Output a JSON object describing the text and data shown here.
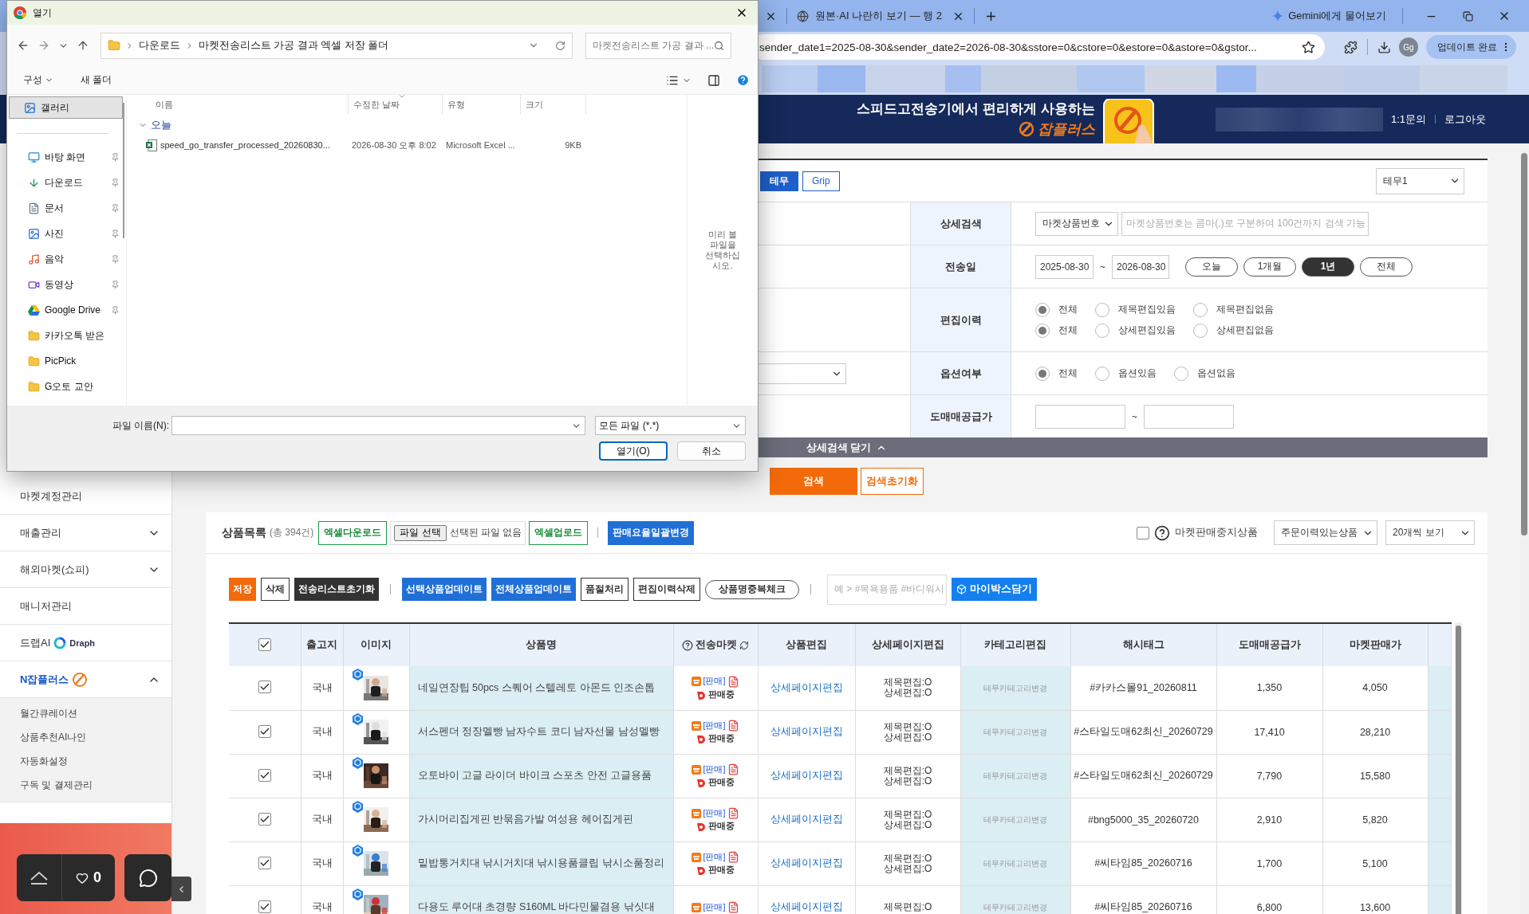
{
  "browser": {
    "tabs": [
      {
        "title": "원본·AI 나란히 보기 — 행 2"
      }
    ],
    "gemini": "Gemini에게 물어보기",
    "address": "sender_date1=2025-08-30&sender_date2=2026-08-30&sstore=0&cstore=0&estore=0&astore=0&gstor...",
    "profile": "Gg",
    "update_button": "업데이트 완료"
  },
  "header": {
    "slogan": "스피드고전송기에서 편리하게 사용하는",
    "logo": "잡플러스",
    "links": [
      "1:1문의",
      "로그아웃"
    ]
  },
  "sidebar": {
    "items": [
      {
        "label": "마켓계정관리"
      },
      {
        "label": "매출관리",
        "expanded": false
      },
      {
        "label": "해외마켓(쇼피)",
        "expanded": false
      },
      {
        "label": "매니저관리"
      },
      {
        "label": "드랩AI",
        "kind": "draph",
        "badge": "Draph"
      },
      {
        "label": "N잡플러스",
        "kind": "njob",
        "expanded": true,
        "children": [
          {
            "label": "월간큐레이션"
          },
          {
            "label": "상품추천AI나인"
          },
          {
            "label": "자동화설정"
          },
          {
            "label": "구독 및 결제관리"
          }
        ]
      }
    ]
  },
  "floating": {
    "likes": "0"
  },
  "search_panel": {
    "market_tabs": [
      {
        "label": "테무",
        "selected": true
      },
      {
        "label": "Grip",
        "selected": false
      }
    ],
    "account_select": "테무1",
    "rows": [
      {
        "kind": "search",
        "label": "상세검색",
        "select": "마켓상품번호",
        "placeholder": "마켓상품번호는 콤마(,)로 구분하여 100건까지 검색 가능"
      },
      {
        "kind": "date",
        "label": "전송일",
        "from": "2025-08-30",
        "separator": "~",
        "to": "2026-08-30",
        "ranges": [
          {
            "label": "오늘",
            "selected": false
          },
          {
            "label": "1개월",
            "selected": false
          },
          {
            "label": "1년",
            "selected": true
          },
          {
            "label": "전체",
            "selected": false
          }
        ]
      },
      {
        "kind": "radio",
        "label": "편집이력",
        "groups": [
          {
            "options": [
              {
                "label": "전체",
                "selected": true
              },
              {
                "label": "제목편집있음",
                "selected": false
              },
              {
                "label": "제목편집없음",
                "selected": false
              }
            ]
          },
          {
            "options": [
              {
                "label": "전체",
                "selected": true
              },
              {
                "label": "상세편집있음",
                "selected": false
              },
              {
                "label": "상세편집없음",
                "selected": false
              }
            ]
          }
        ]
      },
      {
        "kind": "radio",
        "label": "옵션여부",
        "left_control": {
          "kind": "select"
        },
        "groups": [
          {
            "options": [
              {
                "label": "전체",
                "selected": true
              },
              {
                "label": "옵션있음",
                "selected": false
              },
              {
                "label": "옵션없음",
                "selected": false
              }
            ]
          }
        ]
      },
      {
        "kind": "range",
        "label": "도매매공급가",
        "separator": "~"
      }
    ],
    "toggle": "상세검색 닫기",
    "buttons": [
      "검색",
      "검색초기화"
    ]
  },
  "product_list": {
    "title": "상품목록",
    "count": "(총 394건)",
    "excel_download": "엑셀다운로드",
    "file_button": "파일 선택",
    "file_status": "선택된 파일 없음",
    "excel_upload": "엑셀업로드",
    "bulk_rate": "판매요율일괄변경",
    "stopped_filter": {
      "label": "마켓판매중지상품",
      "checked": false
    },
    "order_filter": "주문이력있는상품",
    "page_size": "20개씩 보기",
    "actions": [
      {
        "label": "저장",
        "kind": "orange"
      },
      {
        "label": "삭제",
        "kind": "outline"
      },
      {
        "label": "전송리스트초기화",
        "kind": "dark"
      },
      {
        "kind": "divider"
      },
      {
        "label": "선택상품업데이트",
        "kind": "blue"
      },
      {
        "label": "전체상품업데이트",
        "kind": "blue"
      },
      {
        "label": "품절처리",
        "kind": "outline"
      },
      {
        "label": "편집이력삭제",
        "kind": "outline"
      },
      {
        "label": "상품명중복체크",
        "kind": "pill"
      },
      {
        "kind": "divider"
      }
    ],
    "hashtag_placeholder": "예 > #목욕용품 #바디워시",
    "mybox": "마이박스담기",
    "table": {
      "columns": [
        {
          "kind": "checkbox",
          "checked": true
        },
        {
          "label": "출고지"
        },
        {
          "label": "이미지"
        },
        {
          "label": "상품명"
        },
        {
          "label": "전송마켓",
          "kind": "market"
        },
        {
          "label": "상품편집"
        },
        {
          "label": "상세페이지편집"
        },
        {
          "label": "카테고리편집"
        },
        {
          "label": "해시태그"
        },
        {
          "label": "도매매공급가"
        },
        {
          "label": "마켓판매가"
        },
        {
          "kind": "partial"
        }
      ],
      "rows": [
        {
          "checked": true,
          "origin": "국내",
          "image": {
            "kind": "picture"
          },
          "name": "네일연장팁 50pcs 스퀘어 스텔레토 아몬드 인조손톱",
          "market": {
            "status": "[판매]",
            "state": "판매중"
          },
          "edit_link": "상세페이지편집",
          "edit_history": [
            "제목편집:O",
            "상세편집:O"
          ],
          "category": "테무카테고리변경",
          "hashtag": "#카카스몰91_20260811",
          "supply_price": "1,350",
          "market_price": "4,050"
        },
        {
          "checked": true,
          "origin": "국내",
          "image": {
            "kind": "picture"
          },
          "name": "서스펜더 정장멜빵 남자수트 코디 남자선물 남성멜빵",
          "market": {
            "status": "[판매]",
            "state": "판매중"
          },
          "edit_link": "상세페이지편집",
          "edit_history": [
            "제목편집:O",
            "상세편집:O"
          ],
          "category": "테무카테고리변경",
          "hashtag": "#스타일도매62최신_20260729",
          "supply_price": "17,410",
          "market_price": "28,210"
        },
        {
          "checked": true,
          "origin": "국내",
          "image": {
            "kind": "picture"
          },
          "name": "오토바이 고글 라이더 바이크 스포츠 안전 고글용품",
          "market": {
            "status": "[판매]",
            "state": "판매중"
          },
          "edit_link": "상세페이지편집",
          "edit_history": [
            "제목편집:O",
            "상세편집:O"
          ],
          "category": "테무카테고리변경",
          "hashtag": "#스타일도매62최신_20260729",
          "supply_price": "7,790",
          "market_price": "15,580"
        },
        {
          "checked": true,
          "origin": "국내",
          "image": {
            "kind": "picture"
          },
          "name": "가시머리집게핀 반묶음가발 여성용 헤어집게핀",
          "market": {
            "status": "[판매]",
            "state": "판매중"
          },
          "edit_link": "상세페이지편집",
          "edit_history": [
            "제목편집:O",
            "상세편집:O"
          ],
          "category": "테무카테고리변경",
          "hashtag": "#bng5000_35_20260720",
          "supply_price": "2,910",
          "market_price": "5,820"
        },
        {
          "checked": true,
          "origin": "국내",
          "image": {
            "kind": "picture"
          },
          "name": "밑밥통거치대 낚시거치대 낚시용품클립 낚시소품정리",
          "market": {
            "status": "[판매]",
            "state": "판매중"
          },
          "edit_link": "상세페이지편집",
          "edit_history": [
            "제목편집:O",
            "상세편집:O"
          ],
          "category": "테무카테고리변경",
          "hashtag": "#씨타임85_20260716",
          "supply_price": "1,700",
          "market_price": "5,100"
        },
        {
          "checked": true,
          "origin": "국내",
          "image": {
            "kind": "picture"
          },
          "name": "다용도 루어대 초경량 S160ML 바다민물겸용 낚싯대",
          "market": {
            "status": "[판매]"
          },
          "edit_link": "상세페이지편집",
          "edit_history": [
            "제목편집:O"
          ],
          "category": "테무카테고리변경",
          "hashtag": "#씨타임85_20260716",
          "supply_price": "6,800",
          "market_price": "13,600"
        }
      ]
    }
  },
  "dialog": {
    "title": "열기",
    "path": [
      "다운로드",
      "마켓전송리스트 가공 결과 엑셀 저장 폴더"
    ],
    "search_placeholder": "마켓전송리스트 가공 결과 ...",
    "toolbar": {
      "organize": "구성",
      "new_folder": "새 폴더"
    },
    "nav": [
      {
        "label": "갤러리",
        "kind": "gallery",
        "selected": true
      },
      {
        "label": "바탕 화면",
        "kind": "desktop",
        "selected": false,
        "pinned": true
      },
      {
        "label": "다운로드",
        "kind": "downloads",
        "selected": false,
        "pinned": true
      },
      {
        "label": "문서",
        "kind": "documents",
        "selected": false,
        "pinned": true
      },
      {
        "label": "사진",
        "kind": "pictures",
        "selected": false,
        "pinned": true
      },
      {
        "label": "음악",
        "kind": "music",
        "selected": false,
        "pinned": true
      },
      {
        "label": "동영상",
        "kind": "videos",
        "selected": false,
        "pinned": true
      },
      {
        "label": "Google Drive",
        "kind": "cloud",
        "selected": false,
        "pinned": true
      },
      {
        "label": "카카오톡 받은",
        "kind": "folder",
        "selected": false,
        "pinned": false
      },
      {
        "label": "PicPick",
        "kind": "folder",
        "selected": false,
        "pinned": false
      },
      {
        "label": "G오토 교안",
        "kind": "folder",
        "selected": false,
        "pinned": false
      }
    ],
    "columns": [
      "이름",
      "수정한 날짜",
      "유형",
      "크기"
    ],
    "groups": [
      {
        "label": "오늘",
        "expanded": true,
        "files": [
          {
            "name": "speed_go_transfer_processed_20260830...",
            "modified": "2026-08-30 오후 8:02",
            "type": "Microsoft Excel ...",
            "size": "9KB"
          }
        ]
      }
    ],
    "preview_hint": "미리 볼 파일을 선택하십시오.",
    "filename_label": "파일 이름(N):",
    "filetype": "모든 파일 (*.*)",
    "buttons": [
      {
        "label": "열기(O)",
        "kind": "primary"
      },
      {
        "label": "취소",
        "kind": "secondary"
      }
    ]
  }
}
